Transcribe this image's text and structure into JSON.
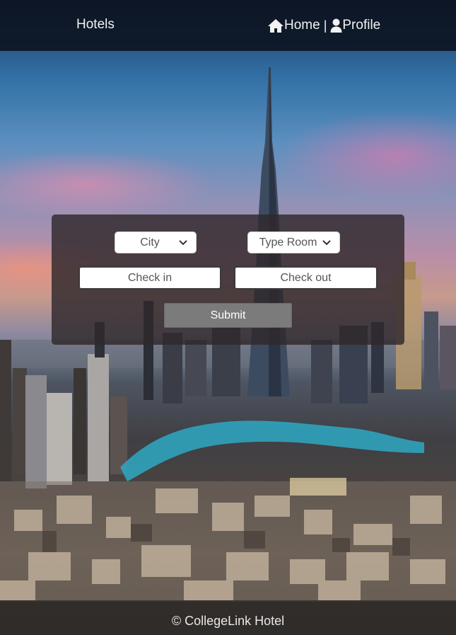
{
  "navbar": {
    "brand": "Hotels",
    "links": [
      {
        "label": "Home",
        "icon": "home-icon"
      },
      {
        "label": "Profile",
        "icon": "user-icon"
      }
    ],
    "separator": "|"
  },
  "search": {
    "city": {
      "selected": "City",
      "options": [
        "City"
      ]
    },
    "room_type": {
      "selected": "Type Room",
      "options": [
        "Type Room"
      ]
    },
    "check_in": {
      "placeholder": "Check in",
      "value": ""
    },
    "check_out": {
      "placeholder": "Check out",
      "value": ""
    },
    "submit_label": "Submit"
  },
  "footer": {
    "text": "© CollegeLink Hotel"
  },
  "colors": {
    "navbar_bg": "#0a101c",
    "panel_bg": "#30282c",
    "button_bg": "#7b7b7b",
    "text_light": "#f2f2f2"
  }
}
